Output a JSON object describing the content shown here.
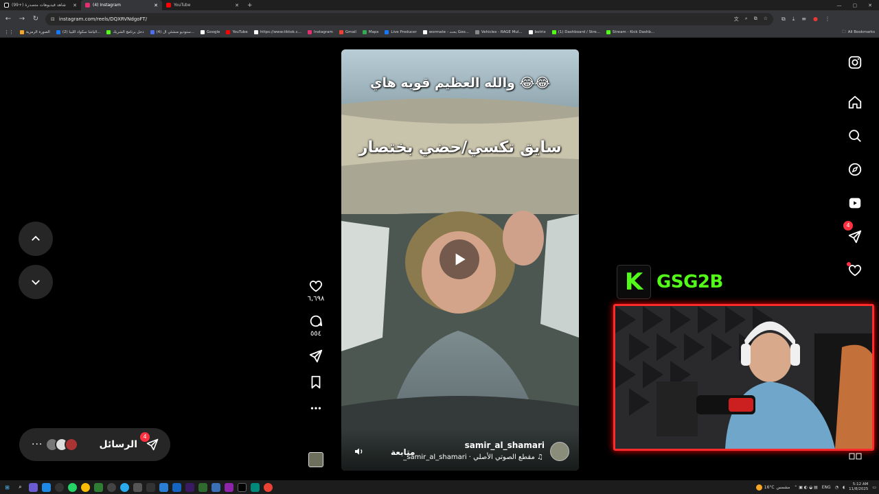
{
  "browser": {
    "tabs": [
      {
        "title": "(99+) شاهد فيديوهات متصدرة",
        "icon_color": "#ffffff",
        "active": false
      },
      {
        "title": "(4) Instagram",
        "icon_color": "#e1306c",
        "active": true
      },
      {
        "title": "YouTube",
        "icon_color": "#ff0000",
        "active": false
      }
    ],
    "new_tab": "+",
    "url": "instagram.com/reels/DQXRVNdgoFT/",
    "bookmarks": [
      {
        "label": "الصورة الرمزية",
        "icon_color": "#f5a623"
      },
      {
        "label": "(2) الياشا سكواد الليبا...",
        "icon_color": "#1877f2"
      },
      {
        "label": "دخل برنامج الشريك",
        "icon_color": "#53fc18"
      },
      {
        "label": "(4) ستوديو منشئي ال...",
        "icon_color": "#4c6ef5"
      },
      {
        "label": "Google",
        "icon_color": "#ffffff"
      },
      {
        "label": "YouTube",
        "icon_color": "#ff0000"
      },
      {
        "label": "https://www.tiktok.c...",
        "icon_color": "#ffffff"
      },
      {
        "label": "Instagram",
        "icon_color": "#e1306c"
      },
      {
        "label": "Gmail",
        "icon_color": "#ea4335"
      },
      {
        "label": "Maps",
        "icon_color": "#34a853"
      },
      {
        "label": "Live Producer",
        "icon_color": "#1877f2"
      },
      {
        "label": "wormate - بحث Goo...",
        "icon_color": "#ffffff"
      },
      {
        "label": "Vehicles - RAGE Mul...",
        "icon_color": "#888888"
      },
      {
        "label": "botrix",
        "icon_color": "#ffffff"
      },
      {
        "label": "(1) Dashboard / Stre...",
        "icon_color": "#53fc18"
      },
      {
        "label": "Stream - Kick Dashb...",
        "icon_color": "#53fc18"
      }
    ],
    "all_bookmarks": "All Bookmarks"
  },
  "reel": {
    "caption_top": "والله العظيم قويه هاي 😂😂",
    "caption_mid": "سايق تكسي/حضي بختصار",
    "username": "samir_al_shamari",
    "follow_label": "متابعة",
    "audio_text": "مقطع الصوتي الأصلي · samir_al_shamari_",
    "likes": "٦,٦٩٨",
    "comments": "٥٥٤"
  },
  "messages": {
    "label": "الرسائل",
    "badge": "4",
    "more": "···"
  },
  "sidenav": {
    "messages_badge": "4"
  },
  "stream_overlay": {
    "kick_letter": "K",
    "channel_name": "GSG2B"
  },
  "taskbar": {
    "temperature": "16°C",
    "weather_label": "مشمس",
    "language": "ENG",
    "time": "5:12 AM",
    "date": "11/8/2025"
  },
  "colors": {
    "kick_green": "#53fc18",
    "notification_red": "#ff3040",
    "webcam_border": "#ff2a2a"
  }
}
